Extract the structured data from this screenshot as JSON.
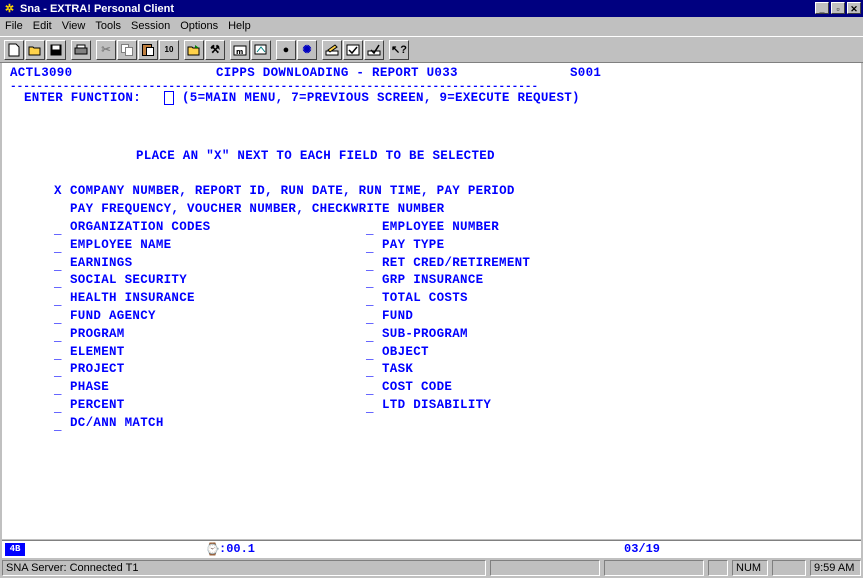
{
  "window": {
    "title": "Sna - EXTRA! Personal Client"
  },
  "menu": [
    "File",
    "Edit",
    "View",
    "Tools",
    "Session",
    "Options",
    "Help"
  ],
  "screen": {
    "program": "ACTL3090",
    "title": "CIPPS DOWNLOADING - REPORT U033",
    "screen_id": "S001",
    "divider": "--------------------------------------------------------------------------------",
    "function_label": "ENTER FUNCTION:",
    "function_hint": "(5=MAIN MENU, 7=PREVIOUS SCREEN, 9=EXECUTE REQUEST)",
    "instruction": "PLACE AN \"X\" NEXT TO EACH FIELD TO BE SELECTED",
    "default_mark": "X",
    "default_line1": "COMPANY NUMBER, REPORT ID, RUN DATE, RUN TIME, PAY PERIOD",
    "default_line2": "PAY FREQUENCY, VOUCHER NUMBER, CHECKWRITE NUMBER",
    "left_fields": [
      "ORGANIZATION CODES",
      "EMPLOYEE NAME",
      "EARNINGS",
      "SOCIAL SECURITY",
      "HEALTH INSURANCE",
      "FUND AGENCY",
      "PROGRAM",
      "ELEMENT",
      "PROJECT",
      "PHASE",
      "PERCENT",
      "DC/ANN MATCH"
    ],
    "right_fields": [
      "EMPLOYEE NUMBER",
      "PAY TYPE",
      "RET CRED/RETIREMENT",
      "GRP INSURANCE",
      "TOTAL COSTS",
      "FUND",
      "SUB-PROGRAM",
      "OBJECT",
      "TASK",
      "COST CODE",
      "LTD DISABILITY"
    ],
    "blank_mark": "_"
  },
  "oia": {
    "indicator": "4B",
    "timer": ":00.1",
    "cursor_pos": "03/19"
  },
  "status": {
    "connection": "SNA Server: Connected T1",
    "num": "NUM",
    "time": "9:59 AM"
  },
  "colors": {
    "terminal_text": "#0000ff",
    "title_bar": "#000080"
  }
}
